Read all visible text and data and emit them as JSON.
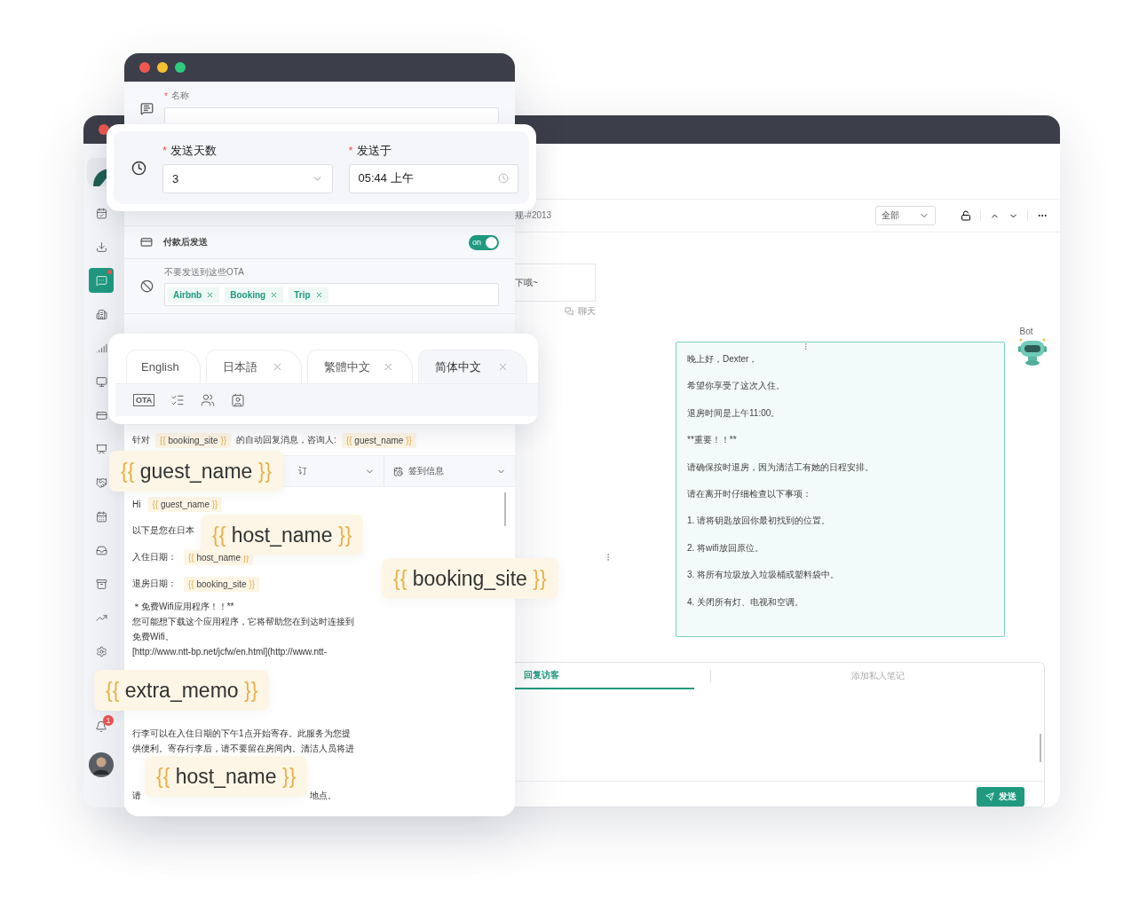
{
  "back_window": {
    "sidebar": {
      "items": [
        {
          "selected": false
        },
        {
          "selected": false
        },
        {
          "selected": true
        },
        {
          "selected": false
        },
        {
          "selected": false
        },
        {
          "selected": false
        },
        {
          "selected": false
        },
        {
          "selected": false
        },
        {
          "selected": false
        },
        {
          "selected": false
        },
        {
          "selected": false
        },
        {
          "selected": false
        },
        {
          "selected": false
        },
        {
          "selected": false
        }
      ],
      "notification_count": "1"
    },
    "toolbar": {
      "title": "规-#2013",
      "filter": "全部"
    },
    "chat": {
      "message": "下哦~",
      "source": "聊天",
      "bot_label": "Bot",
      "bot_lines": [
        "晚上好，Dexter，",
        "希望你享受了这次入住。",
        "退房时间是上午11:00。",
        "**重要！！**",
        "请确保按时退房，因为清洁工有她的日程安排。",
        "请在离开时仔细检查以下事项：",
        "1. 请将钥匙放回你最初找到的位置。",
        "2. 将wifi放回原位。",
        "3. 将所有垃圾放入垃圾桶或塑料袋中。",
        "4. 关闭所有灯、电视和空调。"
      ]
    },
    "composer": {
      "tabs": [
        {
          "label": "回复访客",
          "selected": true
        },
        {
          "label": "添加私人笔记",
          "selected": false
        }
      ],
      "send": "发送"
    }
  },
  "front_window": {
    "name_field": {
      "label": "名称",
      "required_mark": "*"
    },
    "pay_toggle": {
      "label": "付款后发送",
      "on": true,
      "state_text": "on"
    },
    "ota_exclude": {
      "label": "不要发送到这些OTA",
      "tags": [
        "Airbnb",
        "Booking",
        "Trip"
      ]
    },
    "intro": {
      "prefix": "针对",
      "site": {
        "open": "{{",
        "name": "booking_site",
        "close": "}}"
      },
      "middle": "的自动回复消息，咨询人:",
      "guest": {
        "open": "{{",
        "name": "guest_name",
        "close": "}}"
      }
    },
    "selects": [
      {
        "value": "订"
      },
      {
        "value": "签到信息"
      }
    ],
    "body": [
      {
        "kind": "chip",
        "text": "Hi",
        "chip": {
          "open": "{{",
          "name": "guest_name",
          "close": "}}"
        }
      },
      {
        "kind": "text",
        "text": "以下是您在日本"
      },
      {
        "kind": "chip",
        "text": "入住日期：",
        "chip": {
          "open": "{{",
          "name": "host_name",
          "close": "}}"
        }
      },
      {
        "kind": "chip",
        "text": "退房日期：",
        "chip": {
          "open": "{{",
          "name": "booking_site",
          "close": "}}"
        }
      },
      {
        "kind": "para",
        "lines": [
          "＊免费Wifi应用程序！！**",
          "您可能想下载这个应用程序，它将帮助您在到达时连接到",
          "免费Wifi。",
          "[http://www.ntt-bp.net/jcfw/en.html](http://www.ntt-"
        ]
      },
      {
        "kind": "para",
        "lines": [
          "行李可以在入住日期的下午1点开始寄存。此服务为您提",
          "供便利。寄存行李后，请不要留在房间内。清洁人员将进"
        ]
      },
      {
        "kind": "split",
        "left": "请",
        "right": "地点。"
      }
    ]
  },
  "schedule_card": {
    "days_label": "发送天数",
    "days_value": "3",
    "time_label": "发送于",
    "time_value": "05:44 上午",
    "required_mark": "*"
  },
  "language_tabs": {
    "tabs": [
      {
        "label": "English",
        "closable": false,
        "selected": false
      },
      {
        "label": "日本語",
        "closable": true,
        "selected": false
      },
      {
        "label": "繁體中文",
        "closable": true,
        "selected": false
      },
      {
        "label": "简体中文",
        "closable": true,
        "selected": true
      }
    ],
    "ota_icon": "OTA"
  },
  "floating_variables": [
    {
      "open": "{{",
      "name": "guest_name",
      "close": "}}"
    },
    {
      "open": "{{",
      "name": "host_name",
      "close": "}}"
    },
    {
      "open": "{{",
      "name": "booking_site",
      "close": "}}"
    },
    {
      "open": "{{",
      "name": "extra_memo",
      "close": "}}"
    },
    {
      "open": "{{",
      "name": "host_name",
      "close": "}}"
    }
  ]
}
